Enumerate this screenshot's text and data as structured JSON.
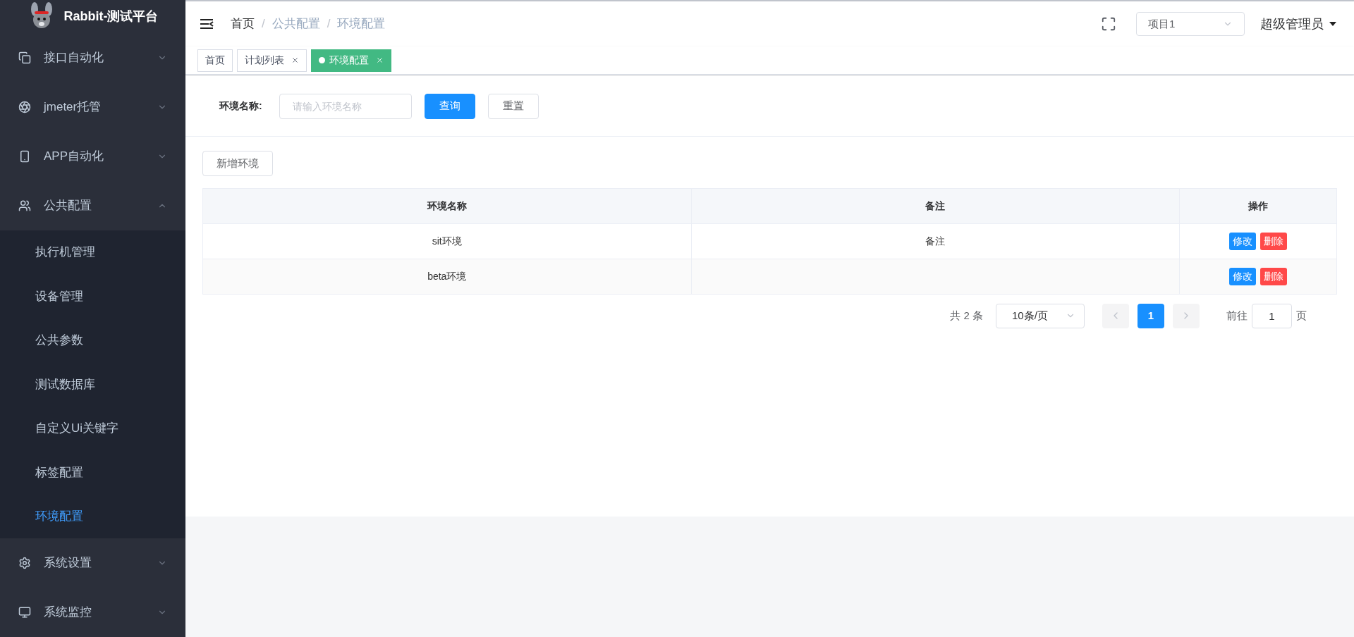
{
  "brand": {
    "title": "Rabbit-测试平台"
  },
  "sidebar": {
    "items": [
      {
        "label": "接口自动化",
        "kind": "links",
        "expanded": false
      },
      {
        "label": "jmeter托管",
        "kind": "target",
        "expanded": false
      },
      {
        "label": "APP自动化",
        "kind": "phone",
        "expanded": false
      },
      {
        "label": "公共配置",
        "kind": "users",
        "expanded": true,
        "children": [
          {
            "label": "执行机管理",
            "selected": false
          },
          {
            "label": "设备管理",
            "selected": false
          },
          {
            "label": "公共参数",
            "selected": false
          },
          {
            "label": "测试数据库",
            "selected": false
          },
          {
            "label": "自定义Ui关键字",
            "selected": false
          },
          {
            "label": "标签配置",
            "selected": false
          },
          {
            "label": "环境配置",
            "selected": true
          }
        ]
      },
      {
        "label": "系统设置",
        "kind": "gear",
        "expanded": false
      },
      {
        "label": "系统监控",
        "kind": "monitor",
        "expanded": false
      }
    ]
  },
  "breadcrumb": [
    {
      "label": "首页"
    },
    {
      "separator": "/",
      "label": "公共配置"
    },
    {
      "separator": "/",
      "label": "环境配置"
    }
  ],
  "project_select": {
    "value": "项目1"
  },
  "user": {
    "name": "超级管理员"
  },
  "tags": [
    {
      "label": "首页",
      "selected": false,
      "closable": false
    },
    {
      "label": "计划列表",
      "selected": false,
      "closable": true
    },
    {
      "label": "环境配置",
      "selected": true,
      "closable": true
    }
  ],
  "filter": {
    "label": "环境名称:",
    "placeholder": "请输入环境名称",
    "buttons": [
      {
        "label": "查询",
        "kind": "primary"
      },
      {
        "label": "重置",
        "kind": "default"
      }
    ]
  },
  "add_button": "新增环境",
  "table": {
    "columns": [
      "环境名称",
      "备注",
      "操作"
    ],
    "rows": [
      {
        "cells": [
          "sit环境",
          "备注"
        ],
        "actions": [
          {
            "label": "修改",
            "kind": "edit"
          },
          {
            "label": "删除",
            "kind": "delete"
          }
        ]
      },
      {
        "cells": [
          "beta环境",
          ""
        ],
        "actions": [
          {
            "label": "修改",
            "kind": "edit"
          },
          {
            "label": "删除",
            "kind": "delete"
          }
        ]
      }
    ]
  },
  "pagination": {
    "total": "共 2 条",
    "page_size": "10条/页",
    "pages": [
      {
        "label": "1",
        "selected": true
      }
    ],
    "goto_label": "前往",
    "goto_value": "1",
    "goto_suffix": "页"
  }
}
